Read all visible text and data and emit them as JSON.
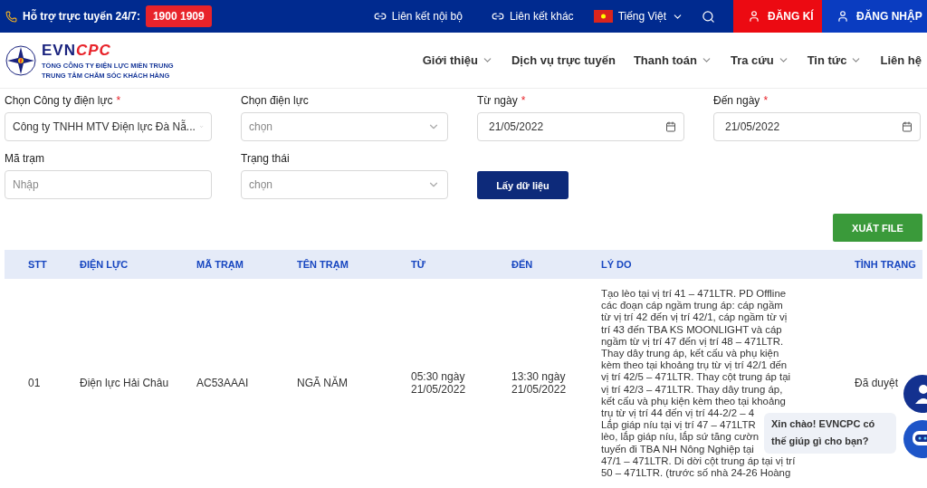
{
  "top_bar": {
    "support_label": "Hỗ trợ trực tuyến 24/7:",
    "hotline": "1900 1909",
    "links": [
      {
        "label": "Liên kết nội bộ"
      },
      {
        "label": "Liên kết khác"
      }
    ],
    "language": "Tiếng Việt",
    "register": "ĐĂNG KÍ",
    "login": "ĐĂNG NHẬP"
  },
  "logo": {
    "brand_a": "EVN",
    "brand_b": "CPC",
    "line_1": "TỔNG CÔNG TY ĐIỆN LỰC MIỀN TRUNG",
    "line_2": "TRUNG TÂM CHĂM SÓC KHÁCH HÀNG"
  },
  "nav": [
    {
      "label": "Giới thiệu",
      "has_menu": true
    },
    {
      "label": "Dịch vụ trực tuyến",
      "has_menu": false
    },
    {
      "label": "Thanh toán",
      "has_menu": true
    },
    {
      "label": "Tra cứu",
      "has_menu": true
    },
    {
      "label": "Tin tức",
      "has_menu": true
    },
    {
      "label": "Liên hệ",
      "has_menu": false
    }
  ],
  "filters": [
    {
      "kind": "select",
      "label": "Chọn Công ty điện lực",
      "required_mark": "*",
      "value": "Công ty TNHH MTV Điện lực Đà Nẵ..."
    },
    {
      "kind": "select",
      "label": "Chọn điện lực",
      "placeholder": "chọn"
    },
    {
      "kind": "date",
      "label": "Từ ngày",
      "required_mark": "*",
      "value": "21/05/2022"
    },
    {
      "kind": "date",
      "label": "Đến ngày",
      "required_mark": "*",
      "value": "21/05/2022"
    },
    {
      "kind": "text",
      "label": "Mã trạm",
      "placeholder": "Nhập"
    },
    {
      "kind": "select",
      "label": "Trạng thái",
      "placeholder": "chọn"
    }
  ],
  "fetch_button": "Lấy dữ liệu",
  "export_button": "XUẤT FILE",
  "table": {
    "columns": [
      "STT",
      "ĐIỆN LỰC",
      "MÃ TRẠM",
      "TÊN TRẠM",
      "TỪ",
      "ĐẾN",
      "LÝ DO",
      "TÌNH TRẠNG"
    ],
    "rows": [
      {
        "cells": [
          "01",
          "Điện lực Hải Châu",
          "AC53AAAI",
          "NGÃ NĂM",
          "05:30 ngày\n21/05/2022",
          "13:30 ngày\n21/05/2022",
          [
            "Tạo lèo tại vị trí 41 – 471LTR. PD Offline",
            "các đoạn cáp ngầm trung áp: cáp ngầm",
            "từ vị trí 42 đến vị trí 42/1, cáp ngầm từ vị",
            "trí 43 đến TBA KS MOONLIGHT và cáp",
            "ngầm từ vị trí 47 đến vị trí 48 – 471LTR.",
            "Thay dây trung áp, kết cấu và phụ kiện",
            "kèm theo tại khoảng trụ từ vị trí 42/1 đến",
            "vị trí 42/5 – 471LTR. Thay cột trung áp tại",
            "vị trí 42/3 – 471LTR. Thay dây trung áp,",
            "kết cấu và phụ kiện kèm theo tại khoảng",
            "trụ từ vị trí 44 đến vị trí 44-2/2 – 4",
            "Lắp giáp níu tại vị trí 47 – 471LTR",
            "lèo, lắp giáp níu, lắp sứ tăng cườn",
            "tuyến đi TBA NH Nông Nghiệp tại",
            "47/1 – 471LTR. Di dời cột trung áp tại vị trí",
            "50 – 471LTR. (trước số nhà 24-26 Hoàng"
          ],
          "Đã duyệt"
        ]
      }
    ]
  },
  "chat": {
    "greeting": "Xin chào! EVNCPC có\nthế giúp gì cho bạn?"
  }
}
